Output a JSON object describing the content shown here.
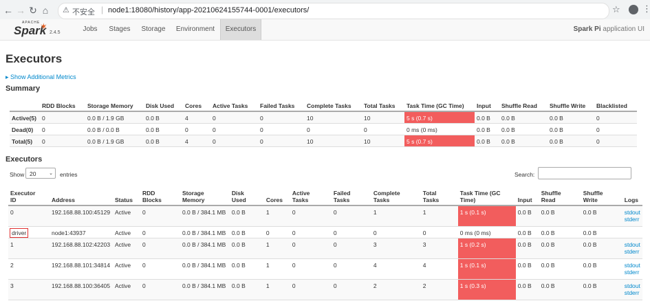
{
  "browser": {
    "back_icon": "arrow-left-icon",
    "forward_icon": "arrow-right-icon",
    "reload_icon": "reload-icon",
    "home_icon": "home-icon",
    "security_label": "不安全",
    "url": "node1:18080/history/app-20210624155744-0001/executors/"
  },
  "nav": {
    "logo_apache": "APACHE",
    "logo_word": "Spark",
    "version": "2.4.5",
    "tabs": [
      "Jobs",
      "Stages",
      "Storage",
      "Environment",
      "Executors"
    ],
    "active_tab": "Executors",
    "app_name": "Spark Pi",
    "app_suffix": "application UI"
  },
  "page": {
    "title": "Executors",
    "additional_metrics": "Show Additional Metrics",
    "summary_heading": "Summary",
    "executors_heading": "Executors"
  },
  "summary": {
    "headers": [
      "",
      "RDD Blocks",
      "Storage Memory",
      "Disk Used",
      "Cores",
      "Active Tasks",
      "Failed Tasks",
      "Complete Tasks",
      "Total Tasks",
      "Task Time (GC Time)",
      "Input",
      "Shuffle Read",
      "Shuffle Write",
      "Blacklisted"
    ],
    "rows": [
      [
        "Active(5)",
        "0",
        "0.0 B / 1.9 GB",
        "0.0 B",
        "4",
        "0",
        "0",
        "10",
        "10",
        "5 s (0.7 s)",
        "0.0 B",
        "0.0 B",
        "0.0 B",
        "0"
      ],
      [
        "Dead(0)",
        "0",
        "0.0 B / 0.0 B",
        "0.0 B",
        "0",
        "0",
        "0",
        "0",
        "0",
        "0 ms (0 ms)",
        "0.0 B",
        "0.0 B",
        "0.0 B",
        "0"
      ],
      [
        "Total(5)",
        "0",
        "0.0 B / 1.9 GB",
        "0.0 B",
        "4",
        "0",
        "0",
        "10",
        "10",
        "5 s (0.7 s)",
        "0.0 B",
        "0.0 B",
        "0.0 B",
        "0"
      ]
    ]
  },
  "controls": {
    "show_label": "Show",
    "page_size": "20",
    "entries_label": "entries",
    "search_label": "Search:"
  },
  "executors": {
    "headers": [
      [
        "Executor",
        "ID"
      ],
      [
        "Address",
        ""
      ],
      [
        "Status",
        ""
      ],
      [
        "RDD",
        "Blocks"
      ],
      [
        "Storage",
        "Memory"
      ],
      [
        "Disk",
        "Used"
      ],
      [
        "Cores",
        ""
      ],
      [
        "Active",
        "Tasks"
      ],
      [
        "Failed",
        "Tasks"
      ],
      [
        "Complete",
        "Tasks"
      ],
      [
        "Total",
        "Tasks"
      ],
      [
        "Task Time (GC",
        "Time)"
      ],
      [
        "Input",
        ""
      ],
      [
        "Shuffle",
        "Read"
      ],
      [
        "Shuffle",
        "Write"
      ],
      [
        "Logs",
        ""
      ]
    ],
    "rows": [
      {
        "id": "0",
        "address": "192.168.88.100:45129",
        "status": "Active",
        "rdd": "0",
        "storage": "0.0 B / 384.1 MB",
        "disk": "0.0 B",
        "cores": "1",
        "active": "0",
        "failed": "0",
        "complete": "1",
        "total": "1",
        "task_time": "1 s (0.1 s)",
        "input": "0.0 B",
        "shuffle_read": "0.0 B",
        "shuffle_write": "0.0 B",
        "stdout": "stdout",
        "stderr": "stderr"
      },
      {
        "id": "driver",
        "address": "node1:43937",
        "status": "Active",
        "rdd": "0",
        "storage": "0.0 B / 384.1 MB",
        "disk": "0.0 B",
        "cores": "0",
        "active": "0",
        "failed": "0",
        "complete": "0",
        "total": "0",
        "task_time": "0 ms (0 ms)",
        "input": "0.0 B",
        "shuffle_read": "0.0 B",
        "shuffle_write": "0.0 B",
        "stdout": "",
        "stderr": ""
      },
      {
        "id": "1",
        "address": "192.168.88.102:42203",
        "status": "Active",
        "rdd": "0",
        "storage": "0.0 B / 384.1 MB",
        "disk": "0.0 B",
        "cores": "1",
        "active": "0",
        "failed": "0",
        "complete": "3",
        "total": "3",
        "task_time": "1 s (0.2 s)",
        "input": "0.0 B",
        "shuffle_read": "0.0 B",
        "shuffle_write": "0.0 B",
        "stdout": "stdout",
        "stderr": "stderr"
      },
      {
        "id": "2",
        "address": "192.168.88.101:34814",
        "status": "Active",
        "rdd": "0",
        "storage": "0.0 B / 384.1 MB",
        "disk": "0.0 B",
        "cores": "1",
        "active": "0",
        "failed": "0",
        "complete": "4",
        "total": "4",
        "task_time": "1 s (0.1 s)",
        "input": "0.0 B",
        "shuffle_read": "0.0 B",
        "shuffle_write": "0.0 B",
        "stdout": "stdout",
        "stderr": "stderr"
      },
      {
        "id": "3",
        "address": "192.168.88.100:36405",
        "status": "Active",
        "rdd": "0",
        "storage": "0.0 B / 384.1 MB",
        "disk": "0.0 B",
        "cores": "1",
        "active": "0",
        "failed": "0",
        "complete": "2",
        "total": "2",
        "task_time": "1 s (0.3 s)",
        "input": "0.0 B",
        "shuffle_read": "0.0 B",
        "shuffle_write": "0.0 B",
        "stdout": "stdout",
        "stderr": "stderr"
      }
    ]
  },
  "colors": {
    "task_time_highlight": "#f25d5d",
    "link": "#0088cc",
    "annotation_box": "#e03030"
  }
}
